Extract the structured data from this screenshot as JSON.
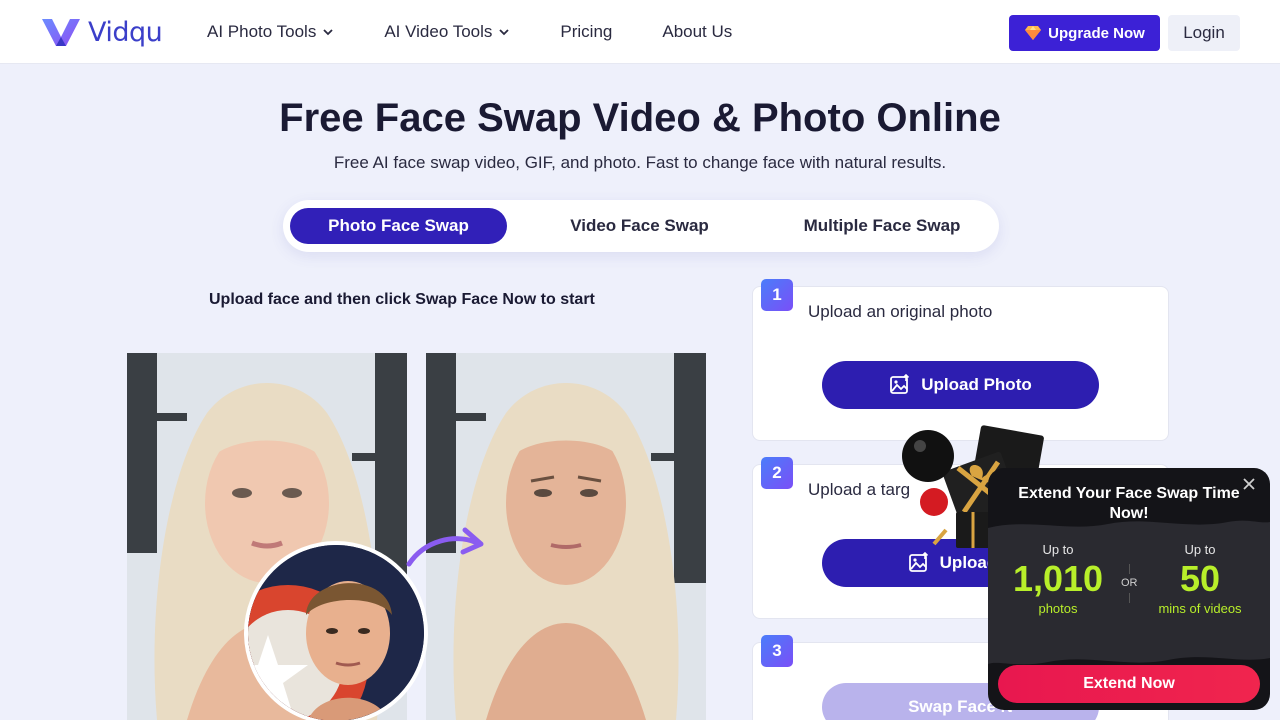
{
  "header": {
    "logo_text": "Vidqu",
    "nav": [
      {
        "label": "AI Photo Tools",
        "has_dropdown": true
      },
      {
        "label": "AI Video Tools",
        "has_dropdown": true
      },
      {
        "label": "Pricing",
        "has_dropdown": false
      },
      {
        "label": "About Us",
        "has_dropdown": false
      }
    ],
    "upgrade_label": "Upgrade Now",
    "login_label": "Login"
  },
  "hero": {
    "title": "Free Face Swap Video & Photo Online",
    "subtitle": "Free AI face swap video, GIF, and photo. Fast to change face with natural results."
  },
  "tabs": [
    {
      "label": "Photo Face Swap",
      "active": true
    },
    {
      "label": "Video Face Swap",
      "active": false
    },
    {
      "label": "Multiple Face Swap",
      "active": false
    }
  ],
  "instruction": "Upload face and then click Swap Face Now to start",
  "steps": [
    {
      "number": "1",
      "label": "Upload an original photo",
      "button": "Upload Photo"
    },
    {
      "number": "2",
      "label": "Upload a targ",
      "button": "Upload P"
    },
    {
      "number": "3",
      "label": "",
      "button": "Swap Face N"
    }
  ],
  "promo": {
    "title": "Extend Your Face Swap Time Now!",
    "left": {
      "upto": "Up to",
      "value": "1,010",
      "unit": "photos"
    },
    "or": "OR",
    "right": {
      "upto": "Up to",
      "value": "50",
      "unit": "mins of videos"
    },
    "button": "Extend Now"
  },
  "colors": {
    "primary": "#2d1eb0",
    "accent_green": "#b8ef2a",
    "promo_button": "#e8174f",
    "background": "#eef0fb"
  }
}
